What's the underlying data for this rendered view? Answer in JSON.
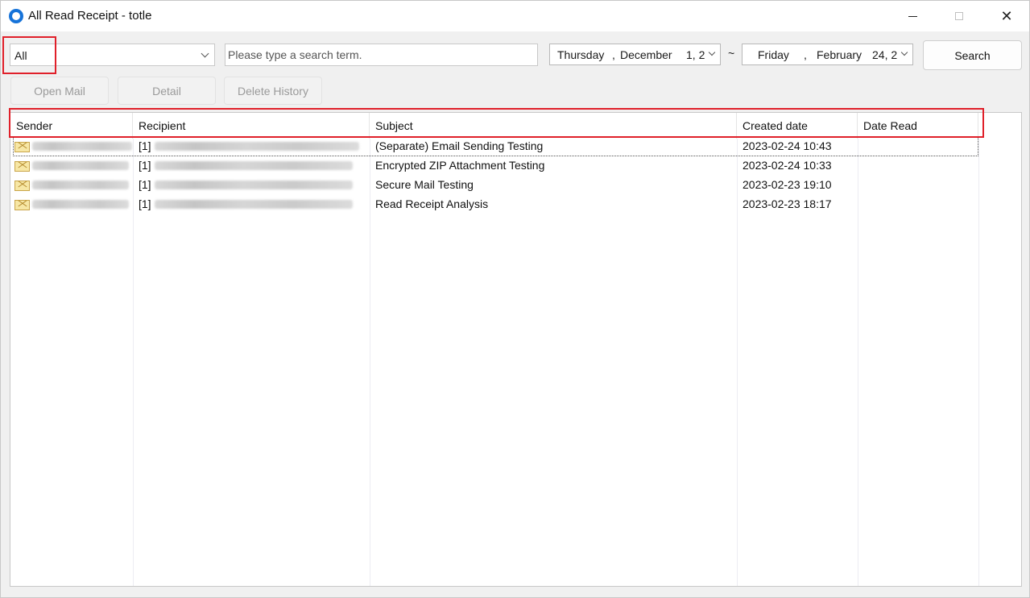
{
  "window": {
    "title": "All Read Receipt - totle",
    "minimize_icon": "minimize-icon",
    "maximize_icon": "maximize-icon",
    "close_icon": "close-icon"
  },
  "filter": {
    "selected": "All"
  },
  "search": {
    "placeholder": "Please type a search term.",
    "value": ""
  },
  "date_range": {
    "from": {
      "weekday": "Thursday",
      "sep1": ",",
      "month": "December",
      "day": "1, 2"
    },
    "separator": "~",
    "to": {
      "weekday": "Friday",
      "sep1": ",",
      "month": "February",
      "day": "24, 2"
    }
  },
  "buttons": {
    "search": "Search",
    "open_mail": "Open Mail",
    "detail": "Detail",
    "delete_history": "Delete History"
  },
  "table": {
    "columns": [
      "Sender",
      "Recipient",
      "Subject",
      "Created date",
      "Date Read"
    ],
    "rows": [
      {
        "recipient_prefix": "[1]",
        "subject": "(Separate) Email Sending Testing",
        "created": "2023-02-24 10:43",
        "read": ""
      },
      {
        "recipient_prefix": "[1]",
        "subject": "Encrypted ZIP Attachment Testing",
        "created": "2023-02-24 10:33",
        "read": ""
      },
      {
        "recipient_prefix": "[1]",
        "subject": "Secure Mail Testing",
        "created": "2023-02-23 19:10",
        "read": ""
      },
      {
        "recipient_prefix": "[1]",
        "subject": "Read Receipt Analysis",
        "created": "2023-02-23 18:17",
        "read": ""
      }
    ]
  },
  "colors": {
    "highlight": "#e0202a",
    "app_icon": "#1673d9"
  }
}
